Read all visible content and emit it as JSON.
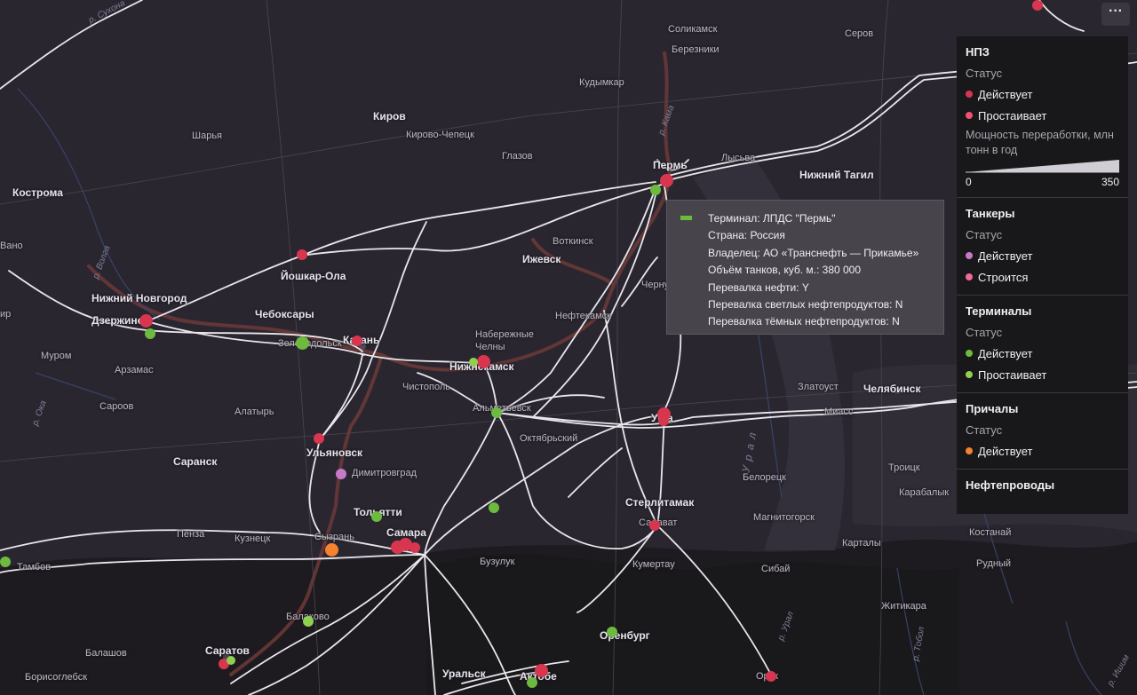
{
  "menu": {
    "label": "···"
  },
  "tooltip": {
    "terminal": "Терминал: ЛПДС \"Пермь\"",
    "country": "Страна: Россия",
    "owner": "Владелец: АО «Транснефть — Прикамье»",
    "tanks": "Объём танков, куб. м.: 380 000",
    "oil": "Перевалка нефти: Y",
    "light": "Перевалка светлых нефтепродуктов: N",
    "dark": "Перевалка тёмных нефтепродуктов: N"
  },
  "legend": {
    "refineries": {
      "title": "НПЗ",
      "status_label": "Статус",
      "items": [
        {
          "label": "Действует",
          "color": "#d8364f"
        },
        {
          "label": "Простаивает",
          "color": "#f2526f"
        }
      ],
      "capacity_label": "Мощность переработки, млн тонн в год",
      "scale_min": "0",
      "scale_max": "350"
    },
    "tankers": {
      "title": "Танкеры",
      "status_label": "Статус",
      "items": [
        {
          "label": "Действует",
          "color": "#c57ac7"
        },
        {
          "label": "Строится",
          "color": "#f06a9c"
        }
      ]
    },
    "terminals": {
      "title": "Терминалы",
      "status_label": "Статус",
      "items": [
        {
          "label": "Действует",
          "color": "#6cbb3e"
        },
        {
          "label": "Простаивает",
          "color": "#8fd14f"
        }
      ]
    },
    "berths": {
      "title": "Причалы",
      "status_label": "Статус",
      "items": [
        {
          "label": "Действует",
          "color": "#f5822e"
        }
      ]
    },
    "pipelines": {
      "title": "Нефтепроводы"
    }
  },
  "cities": [
    {
      "name": "Соликамск"
    },
    {
      "name": "Серов"
    },
    {
      "name": "Березники"
    },
    {
      "name": "Кудымкар"
    },
    {
      "name": "Киров"
    },
    {
      "name": "Кирово-Чепецк"
    },
    {
      "name": "Глазов"
    },
    {
      "name": "Шарья"
    },
    {
      "name": "Кострома"
    },
    {
      "name": "Пермь"
    },
    {
      "name": "Лысьва"
    },
    {
      "name": "Нижний Тагил"
    },
    {
      "name": "Воткинск"
    },
    {
      "name": "Ижевск"
    },
    {
      "name": "Йошкар-Ола"
    },
    {
      "name": "Нижний Новгород"
    },
    {
      "name": "Чебоксары"
    },
    {
      "name": "Дзержинск"
    },
    {
      "name": "Зеленодольск"
    },
    {
      "name": "Казань"
    },
    {
      "name": "Набережные Челны"
    },
    {
      "name": "Нефтекамск"
    },
    {
      "name": "Нижнекамск"
    },
    {
      "name": "Муром"
    },
    {
      "name": "Арзамас"
    },
    {
      "name": "Чистополь"
    },
    {
      "name": "Альметьевск"
    },
    {
      "name": "Златоуст"
    },
    {
      "name": "Челябинск"
    },
    {
      "name": "Миасс"
    },
    {
      "name": "Сароов"
    },
    {
      "name": "Алатырь"
    },
    {
      "name": "Октябрьский"
    },
    {
      "name": "Саранск"
    },
    {
      "name": "Ульяновск"
    },
    {
      "name": "Димитровград"
    },
    {
      "name": "Троицк"
    },
    {
      "name": "Белорецк"
    },
    {
      "name": "Карабалык"
    },
    {
      "name": "Стерлитамак"
    },
    {
      "name": "Тольятти"
    },
    {
      "name": "Магнитогорск"
    },
    {
      "name": "Пенза"
    },
    {
      "name": "Кузнецк"
    },
    {
      "name": "Сызрань"
    },
    {
      "name": "Самара"
    },
    {
      "name": "Салават"
    },
    {
      "name": "Карталы"
    },
    {
      "name": "Костанай"
    },
    {
      "name": "Тамбов"
    },
    {
      "name": "Бузулук"
    },
    {
      "name": "Кумертау"
    },
    {
      "name": "Сибай"
    },
    {
      "name": "Рудный"
    },
    {
      "name": "Балаково"
    },
    {
      "name": "Житикара"
    },
    {
      "name": "Саратов"
    },
    {
      "name": "Оренбург"
    },
    {
      "name": "Балашов"
    },
    {
      "name": "Уральск"
    },
    {
      "name": "Борисоглебск"
    },
    {
      "name": "Актобе"
    },
    {
      "name": "Орск"
    },
    {
      "name": "Вано"
    },
    {
      "name": "Чернушка"
    },
    {
      "name": "Уфа"
    },
    {
      "name": "ир"
    }
  ],
  "rivers": [
    {
      "name": "р. Сухона"
    },
    {
      "name": "р. Волга"
    },
    {
      "name": "р. Кама"
    },
    {
      "name": "р. Ока"
    },
    {
      "name": "р. Урал"
    },
    {
      "name": "р. Тобол"
    },
    {
      "name": "р. Ишим"
    },
    {
      "name": "Урал"
    }
  ]
}
